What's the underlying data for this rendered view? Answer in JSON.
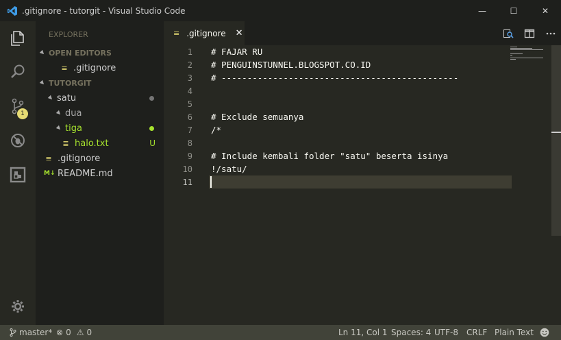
{
  "window": {
    "title": ".gitignore - tutorgit - Visual Studio Code",
    "minimize_glyph": "—",
    "maximize_glyph": "☐",
    "close_glyph": "✕"
  },
  "activity_bar": {
    "items": [
      "explorer-icon",
      "search-icon",
      "source-control-icon",
      "debug-icon",
      "extensions-icon"
    ],
    "scm_badge": "1",
    "settings_icon": "gear-icon"
  },
  "sidebar": {
    "title": "EXPLORER",
    "open_editors_label": "OPEN EDITORS",
    "open_editors": [
      {
        "icon": "≡",
        "label": ".gitignore"
      }
    ],
    "project_label": "TUTORGIT",
    "tree": [
      {
        "label": "satu",
        "type": "folder",
        "open": true,
        "indent": 1,
        "status": "dot-gray"
      },
      {
        "label": "dua",
        "type": "folder",
        "open": true,
        "indent": 2,
        "status": ""
      },
      {
        "label": "tiga",
        "type": "folder",
        "open": true,
        "indent": 2,
        "status": "dot-green"
      },
      {
        "label": "halo.txt",
        "type": "file",
        "icon": "≣",
        "indent": 3,
        "status": "U"
      },
      {
        "label": ".gitignore",
        "type": "file",
        "icon": "≡",
        "indent": 1,
        "status": ""
      },
      {
        "label": "README.md",
        "type": "file",
        "icon": "M↓",
        "indent": 1,
        "status": ""
      }
    ]
  },
  "tabs": [
    {
      "label": ".gitignore",
      "icon": "≡",
      "close": "✕",
      "active": true
    }
  ],
  "editor": {
    "lines": [
      "# FAJAR RU",
      "# PENGUINSTUNNEL.BLOGSPOT.CO.ID",
      "# ----------------------------------------------",
      "",
      "",
      "# Exclude semuanya",
      "/*",
      "",
      "# Include kembali folder \"satu\" beserta isinya",
      "!/satu/",
      ""
    ],
    "line_numbers": [
      "1",
      "2",
      "3",
      "4",
      "5",
      "6",
      "7",
      "8",
      "9",
      "10",
      "11"
    ],
    "current_line": 11
  },
  "statusbar": {
    "branch": "master*",
    "errors": "0",
    "warnings": "0",
    "position": "Ln 11, Col 1",
    "spaces": "Spaces: 4",
    "encoding": "UTF-8",
    "eol": "CRLF",
    "language": "Plain Text"
  },
  "colors": {
    "accent_yellow": "#e6db74",
    "green": "#a6e22e",
    "editor_bg": "#272822"
  }
}
